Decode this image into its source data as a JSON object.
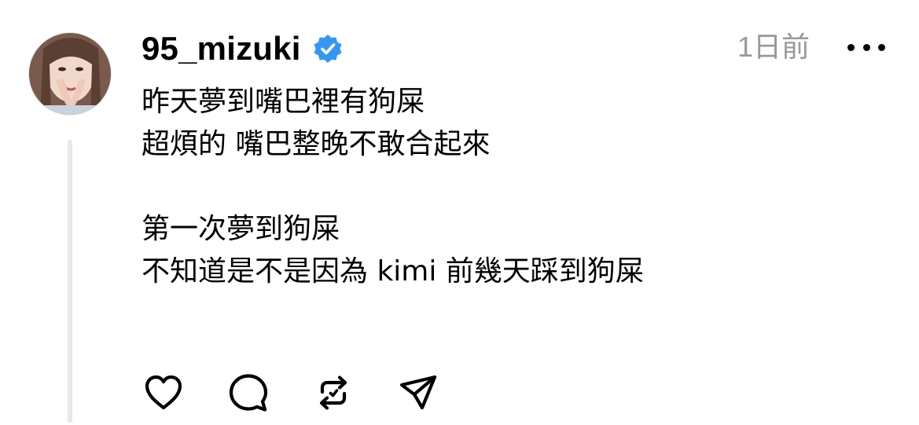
{
  "post": {
    "author": {
      "username": "95_mizuki",
      "verified": true,
      "verified_badge_color": "#3797f0"
    },
    "timestamp": "1日前",
    "more_icon": "more-horizontal-icon",
    "paragraphs": [
      [
        "昨天夢到嘴巴裡有狗屎",
        "超煩的 嘴巴整晚不敢合起來"
      ],
      [
        "第一次夢到狗屎",
        "不知道是不是因為 kimi 前幾天踩到狗屎"
      ]
    ],
    "actions": [
      {
        "name": "like",
        "icon": "heart-icon"
      },
      {
        "name": "comment",
        "icon": "comment-bubble-icon"
      },
      {
        "name": "repost",
        "icon": "repost-icon"
      },
      {
        "name": "share",
        "icon": "send-icon"
      }
    ]
  },
  "colors": {
    "text": "#000000",
    "muted": "#999999",
    "thread_line": "#e8e8e8",
    "verified": "#3797f0"
  }
}
